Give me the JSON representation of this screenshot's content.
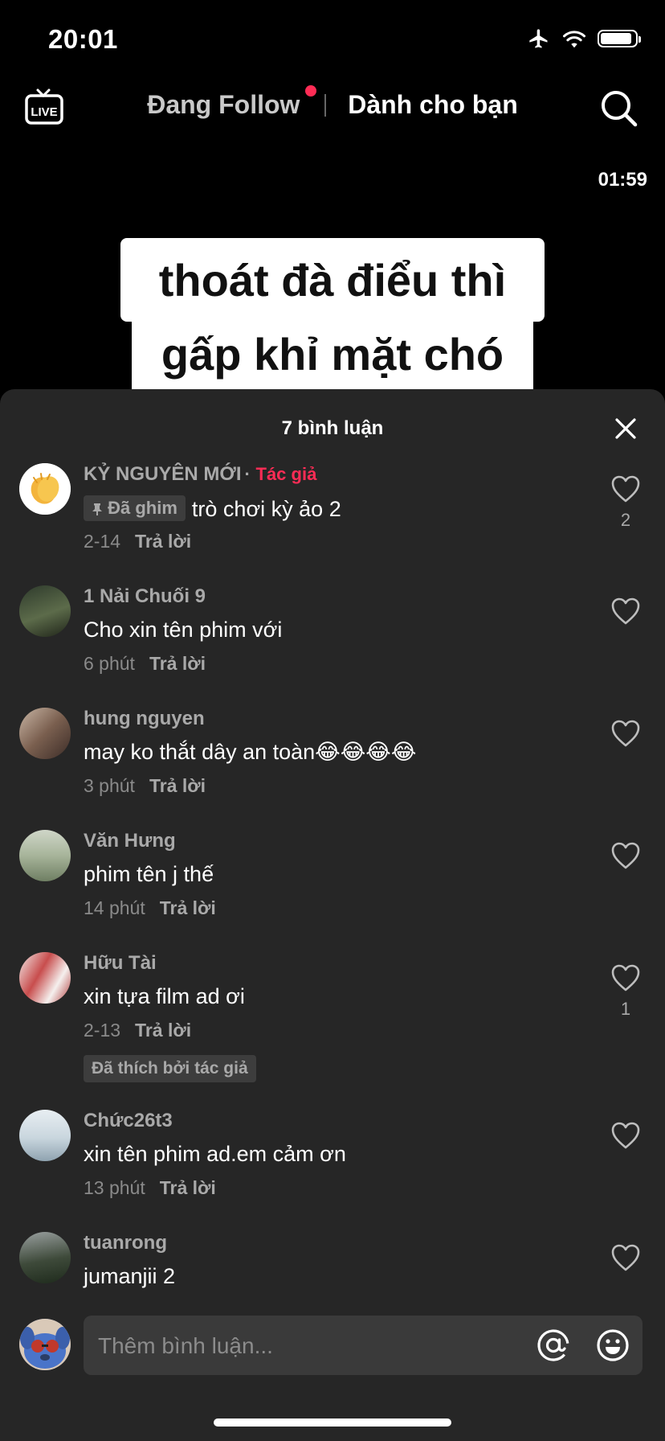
{
  "status_bar": {
    "time": "20:01",
    "battery_level": 0.9
  },
  "top_nav": {
    "live_label": "LIVE",
    "tab_following": "Đang Follow",
    "tab_for_you": "Dành cho bạn"
  },
  "video": {
    "duration": "01:59",
    "caption_line1": "thoát đà điểu thì",
    "caption_line2": "gấp khỉ mặt chó"
  },
  "comments_sheet": {
    "title": "7 bình luận",
    "comments": [
      {
        "user": "KỶ NGUYÊN MỚI",
        "author_tag": "Tác giả",
        "pinned_label": "Đã ghim",
        "text": "trò chơi kỳ ảo 2",
        "time": "2-14",
        "reply": "Trả lời",
        "likes": "2"
      },
      {
        "user": "1 Nải Chuối 9",
        "text": "Cho xin tên phim với",
        "time": "6 phút",
        "reply": "Trả lời"
      },
      {
        "user": "hung nguyen",
        "text": "may ko thắt dây an toàn😂😂😂😂",
        "time": "3 phút",
        "reply": "Trả lời"
      },
      {
        "user": "Văn Hưng",
        "text": "phim tên j thế",
        "time": "14 phút",
        "reply": "Trả lời"
      },
      {
        "user": "Hữu Tài",
        "text": "xin tựa film ad ơi",
        "time": "2-13",
        "reply": "Trả lời",
        "likes": "1",
        "liked_by_author": "Đã thích bởi tác giả"
      },
      {
        "user": "Chức26t3",
        "text": "xin tên phim ad.em cảm ơn",
        "time": "13 phút",
        "reply": "Trả lời"
      },
      {
        "user": "tuanrong",
        "text": "jumanjii 2"
      }
    ]
  },
  "input": {
    "placeholder": "Thêm bình luận..."
  },
  "colors": {
    "accent": "#fe2c55",
    "sheet_bg": "#262626",
    "muted": "#a9a9a9"
  }
}
